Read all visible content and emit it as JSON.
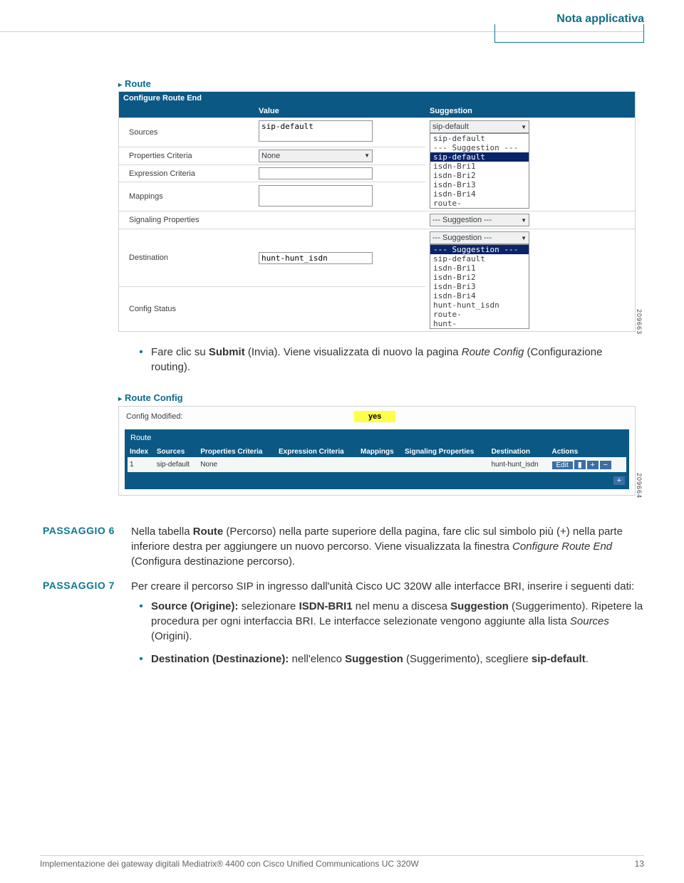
{
  "header": {
    "title": "Nota applicativa"
  },
  "fig1": {
    "title": "Route",
    "section": "Configure Route End",
    "colValue": "Value",
    "colSugg": "Suggestion",
    "rows": {
      "sources": "Sources",
      "sources_val": "sip-default",
      "propcrit": "Properties Criteria",
      "propcrit_val": "None",
      "exprcrit": "Expression Criteria",
      "mappings": "Mappings",
      "sigprop": "Signaling Properties",
      "sigprop_sugg": "--- Suggestion ---",
      "dest": "Destination",
      "dest_val": "hunt-hunt_isdn",
      "dest_sugg": "--- Suggestion ---",
      "cfgstat": "Config Status"
    },
    "popup1_sel": "sip-default",
    "popup1": [
      "sip-default",
      "--- Suggestion ---",
      "sip-default",
      "isdn-Bri1",
      "isdn-Bri2",
      "isdn-Bri3",
      "isdn-Bri4",
      "route-"
    ],
    "popup2_sel": "--- Suggestion ---",
    "popup2": [
      "--- Suggestion ---",
      "sip-default",
      "isdn-Bri1",
      "isdn-Bri2",
      "isdn-Bri3",
      "isdn-Bri4",
      "hunt-hunt_isdn",
      "route-",
      "hunt-"
    ],
    "imgnum": "209663"
  },
  "midtext": {
    "pre": "Fare clic su ",
    "submit": "Submit",
    "post1": " (Invia). Viene visualizzata di nuovo la pagina ",
    "routecfg": "Route Config",
    "post2": " (Configurazione routing)."
  },
  "fig2": {
    "title": "Route Config",
    "modlabel": "Config Modified:",
    "modval": "yes",
    "tbltitle": "Route",
    "headers": [
      "Index",
      "Sources",
      "Properties Criteria",
      "Expression Criteria",
      "Mappings",
      "Signaling Properties",
      "Destination",
      "Actions"
    ],
    "row": [
      "1",
      "sip-default",
      "None",
      "",
      "",
      "",
      "hunt-hunt_isdn"
    ],
    "edit": "Edit",
    "imgnum": "209664"
  },
  "steps": {
    "s6label": "PASSAGGIO 6",
    "s6_a": "Nella tabella ",
    "s6_route": "Route",
    "s6_b": " (Percorso) nella parte superiore della pagina, fare clic sul simbolo più (+) nella parte inferiore destra per aggiungere un nuovo percorso. Viene visualizzata la finestra ",
    "s6_cfg": "Configure Route End",
    "s6_c": " (Configura destinazione percorso).",
    "s7label": "PASSAGGIO 7",
    "s7_a": "Per creare il percorso SIP in ingresso dall'unità Cisco UC 320W alle interfacce BRI, inserire i seguenti dati:",
    "b1_a": "Source (Origine):",
    "b1_b": " selezionare ",
    "b1_c": "ISDN-BRI1",
    "b1_d": " nel menu a discesa ",
    "b1_e": "Suggestion",
    "b1_f": " (Suggerimento). Ripetere la procedura per ogni interfaccia BRI. Le interfacce selezionate vengono aggiunte alla lista ",
    "b1_g": "Sources",
    "b1_h": " (Origini).",
    "b2_a": "Destination (Destinazione):",
    "b2_b": " nell'elenco ",
    "b2_c": "Suggestion",
    "b2_d": " (Suggerimento), scegliere ",
    "b2_e": "sip-default",
    "b2_f": "."
  },
  "footer": {
    "left": "Implementazione dei gateway digitali Mediatrix® 4400 con Cisco Unified Communications UC 320W",
    "right": "13"
  }
}
